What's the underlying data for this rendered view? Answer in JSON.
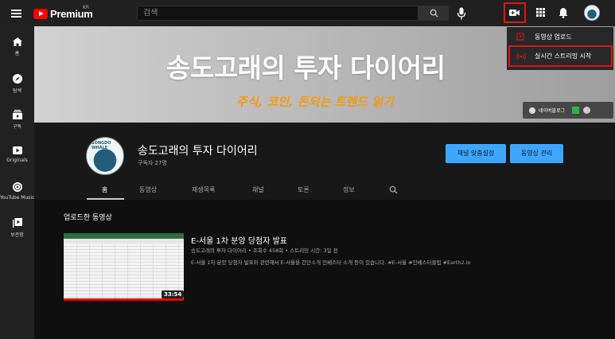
{
  "header": {
    "logo_text": "Premium",
    "region": "KR",
    "search_placeholder": "검색"
  },
  "create_menu": {
    "upload_label": "동영상 업로드",
    "live_label": "실시간 스트리밍 시작"
  },
  "sidebar": {
    "items": [
      {
        "label": "홈",
        "icon": "home-icon"
      },
      {
        "label": "탐색",
        "icon": "explore-icon"
      },
      {
        "label": "구독",
        "icon": "subscriptions-icon"
      },
      {
        "label": "Originals",
        "icon": "originals-icon"
      },
      {
        "label": "YouTube Music",
        "icon": "music-icon"
      },
      {
        "label": "보관함",
        "icon": "library-icon"
      }
    ]
  },
  "banner": {
    "title": "송도고래의 투자 다이어리",
    "subtitle": "주식, 코인, 돈되는 트렌드 읽기",
    "link_label": "네이버블로그"
  },
  "channel": {
    "name": "송도고래의 투자 다이어리",
    "subscribers": "구독자 27명",
    "avatar_text": "SONGDO WHALE",
    "customize_label": "채널 맞춤설정",
    "manage_label": "동영상 관리"
  },
  "tabs": [
    {
      "label": "홈"
    },
    {
      "label": "동영상"
    },
    {
      "label": "재생목록"
    },
    {
      "label": "채널"
    },
    {
      "label": "토론"
    },
    {
      "label": "정보"
    }
  ],
  "uploads": {
    "section_title": "업로드한 동영상",
    "video": {
      "title": "E-서울 1차 분양 당첨자 발표",
      "meta": "송도고래의 투자 다이어리 • 조회수 458회 • 스트리밍 시간: 3일 전",
      "description": "E-서울 1차 분양 당첨자 발표와 관련해서 E-서울을 간단소개 인베스터 소개 등이 있습니다. #E-서울 #인베스터클럽 #Earth2.io",
      "duration": "33:54"
    }
  },
  "colors": {
    "accent_blue": "#3ea6ff",
    "highlight_red": "#e01414",
    "banner_orange": "#f29a14"
  }
}
